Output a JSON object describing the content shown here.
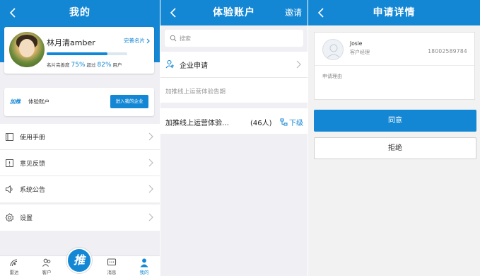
{
  "colors": {
    "accent": "#1487d4",
    "background": "#efeff4",
    "card": "#ffffff"
  },
  "profile_screen": {
    "title": "我的",
    "user": {
      "name": "林月清amber",
      "complete_link": "完善名片",
      "profile_completion_percent": 75,
      "stats_label_1": "名片完善度",
      "stats_value_1": "75%",
      "stats_label_2": "超过",
      "stats_value_2": "82%",
      "stats_label_3": "用户"
    },
    "trial": {
      "logo_text": "加推",
      "label": "体验账户",
      "enter_button": "进入我的企业"
    },
    "menu": [
      {
        "label": "使用手册",
        "icon": "book-icon"
      },
      {
        "label": "意见反馈",
        "icon": "feedback-icon"
      },
      {
        "label": "系统公告",
        "icon": "speaker-icon"
      }
    ],
    "settings": {
      "label": "设置",
      "icon": "gear-icon"
    },
    "tabbar": {
      "radar": "雷达",
      "clients": "客户",
      "center": "推",
      "messages": "消息",
      "mine": "我的"
    }
  },
  "trial_account_screen": {
    "title": "体验账户",
    "invite": "邀请",
    "search_placeholder": "搜索",
    "enterprise_request": "企业申请",
    "group_header": "加推线上运营体验告期",
    "group": {
      "name": "加推线上运营体验…",
      "count": "(46人)",
      "sub_level": "下级"
    }
  },
  "request_detail_screen": {
    "title": "申请详情",
    "applicant": {
      "name": "Josie",
      "role": "客户经理",
      "phone": "18002589784"
    },
    "reason_label": "申请理由",
    "agree_button": "同意",
    "reject_button": "拒绝"
  }
}
